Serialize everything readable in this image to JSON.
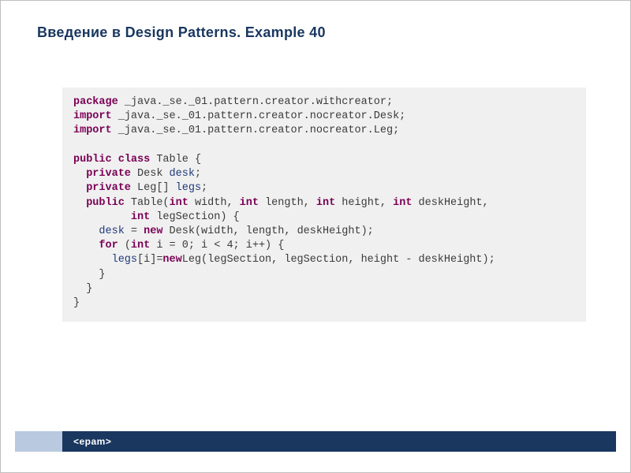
{
  "title": "Введение в Design Patterns. Example 40",
  "footer": {
    "logo": "<epam>"
  },
  "code": {
    "l1": {
      "kw1": "package",
      "rest": " _java._se._01.pattern.creator.withcreator;"
    },
    "l2": {
      "kw1": "import",
      "rest": " _java._se._01.pattern.creator.nocreator.Desk;"
    },
    "l3": {
      "kw1": "import",
      "rest": " _java._se._01.pattern.creator.nocreator.Leg;"
    },
    "l5": {
      "kw1": "public",
      "kw2": "class",
      "rest": " Table {"
    },
    "l6": {
      "indent": "  ",
      "kw1": "private",
      "type": " Desk ",
      "name": "desk",
      "rest": ";"
    },
    "l7": {
      "indent": "  ",
      "kw1": "private",
      "type": " Leg[] ",
      "name": "legs",
      "rest": ";"
    },
    "l8": {
      "indent": "  ",
      "kw1": "public",
      "t1": " Table(",
      "kw2": "int",
      "t2": " width, ",
      "kw3": "int",
      "t3": " length, ",
      "kw4": "int",
      "t4": " height, ",
      "kw5": "int",
      "t5": " deskHeight,"
    },
    "l9": {
      "indent": "         ",
      "kw1": "int",
      "rest": " legSection) {"
    },
    "l10": {
      "indent": "    ",
      "name": "desk",
      "t1": " = ",
      "kw1": "new",
      "rest": " Desk(width, length, deskHeight);"
    },
    "l11": {
      "indent": "    ",
      "kw1": "for",
      "t1": " (",
      "kw2": "int",
      "rest": " i = 0; i < 4; i++) {"
    },
    "l12": {
      "indent": "      ",
      "name": "legs",
      "t1": "[i]=",
      "kw1": "new",
      "rest": "Leg(legSection, legSection, height - deskHeight);"
    },
    "l13": {
      "indent": "    ",
      "rest": "}"
    },
    "l14": {
      "indent": "  ",
      "rest": "}"
    },
    "l15": {
      "rest": "}"
    }
  }
}
